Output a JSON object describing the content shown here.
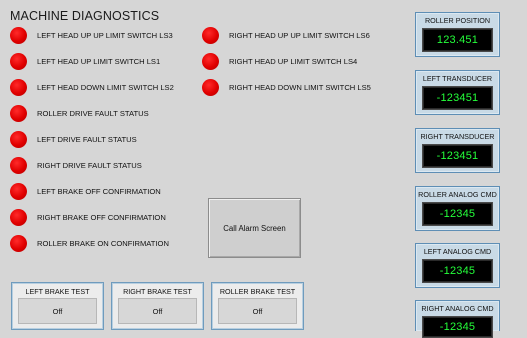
{
  "title": "MACHINE DIAGNOSTICS",
  "colors": {
    "led_on": "#e00000",
    "background": "#d6d6d6",
    "display_text": "#24ff3a",
    "display_bg": "#000000",
    "panel_border": "#5e8eb5"
  },
  "indicators_left": [
    {
      "label": "LEFT HEAD UP UP LIMIT SWITCH LS3",
      "state": "red"
    },
    {
      "label": "LEFT HEAD UP LIMIT SWITCH LS1",
      "state": "red"
    },
    {
      "label": "LEFT HEAD DOWN LIMIT SWITCH LS2",
      "state": "red"
    },
    {
      "label": "ROLLER DRIVE FAULT STATUS",
      "state": "red"
    },
    {
      "label": "LEFT DRIVE FAULT STATUS",
      "state": "red"
    },
    {
      "label": "RIGHT DRIVE FAULT STATUS",
      "state": "red"
    },
    {
      "label": "LEFT BRAKE OFF CONFIRMATION",
      "state": "red"
    },
    {
      "label": "RIGHT BRAKE OFF CONFIRMATION",
      "state": "red"
    },
    {
      "label": "ROLLER BRAKE ON CONFIRMATION",
      "state": "red"
    }
  ],
  "indicators_right": [
    {
      "label": "RIGHT HEAD UP UP LIMIT SWITCH LS6",
      "state": "red"
    },
    {
      "label": "RIGHT HEAD UP LIMIT SWITCH LS4",
      "state": "red"
    },
    {
      "label": "RIGHT HEAD DOWN LIMIT SWITCH LS5",
      "state": "red"
    }
  ],
  "alarm_button": {
    "label": "Call Alarm Screen"
  },
  "brake_tests": [
    {
      "title": "LEFT BRAKE TEST",
      "value": "Off"
    },
    {
      "title": "RIGHT BRAKE TEST",
      "value": "Off"
    },
    {
      "title": "ROLLER BRAKE TEST",
      "value": "Off"
    }
  ],
  "displays": [
    {
      "title": "ROLLER POSITION",
      "value": "123.451"
    },
    {
      "title": "LEFT TRANSDUCER",
      "value": "-123451"
    },
    {
      "title": "RIGHT TRANSDUCER",
      "value": "-123451"
    },
    {
      "title": "ROLLER ANALOG CMD",
      "value": "-12345"
    },
    {
      "title": "LEFT ANALOG CMD",
      "value": "-12345"
    },
    {
      "title": "RIGHT ANALOG CMD",
      "value": "-12345"
    }
  ]
}
